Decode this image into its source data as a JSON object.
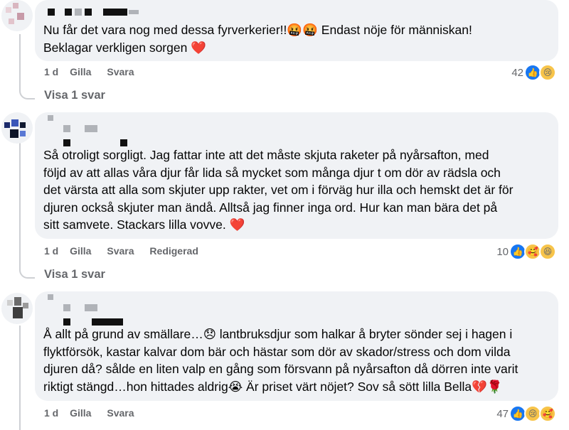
{
  "comments": [
    {
      "lines": [
        "Nu får det vara nog med dessa fyrverkerier!!🤬🤬 Endast nöje för människan!",
        "Beklagar verkligen sorgen ❤️"
      ],
      "time": "1 d",
      "like_label": "Gilla",
      "reply_label": "Svara",
      "reaction_count": "42",
      "reactions": [
        "like-icon",
        "sad-icon"
      ],
      "show_replies": "Visa 1 svar"
    },
    {
      "lines": [
        "Så otroligt sorgligt. Jag fattar inte att det måste skjuta raketer på nyårsafton, med",
        "följd av att allas våra djur får lida så mycket som många djur t om dör av rädsla och",
        "det värsta att alla som skjuter upp rakter, vet om i förväg hur illa och hemskt det är för",
        "djuren också skjuter man ändå. Alltså jag finner inga ord. Hur kan man bära det på",
        "sitt samvete. Stackars lilla vovve. ❤️"
      ],
      "time": "1 d",
      "like_label": "Gilla",
      "reply_label": "Svara",
      "edited_label": "Redigerad",
      "reaction_count": "10",
      "reactions": [
        "like-icon",
        "care-icon",
        "haha-icon"
      ],
      "show_replies": "Visa 1 svar"
    },
    {
      "lines": [
        "Å allt på grund av smällare…😞 lantbruksdjur som halkar å bryter sönder sej i hagen i",
        "flyktförsök, kastar kalvar dom bär och hästar som dör av skador/stress och dom vilda",
        "djuren då? sålde en liten valp en gång som försvann på nyårsafton då dörren inte varit",
        "riktigt stängd…hon hittades aldrig😭 Är priset värt nöjet? Sov så sött lilla Bella💔🌹"
      ],
      "time": "1 d",
      "like_label": "Gilla",
      "reply_label": "Svara",
      "reaction_count": "47",
      "reactions": [
        "like-icon",
        "sad-icon",
        "care-icon"
      ]
    }
  ],
  "colors": {
    "bubble": "#f0f2f5",
    "meta": "#65676b",
    "like": "#1877f2",
    "heart": "#e41e3f"
  }
}
